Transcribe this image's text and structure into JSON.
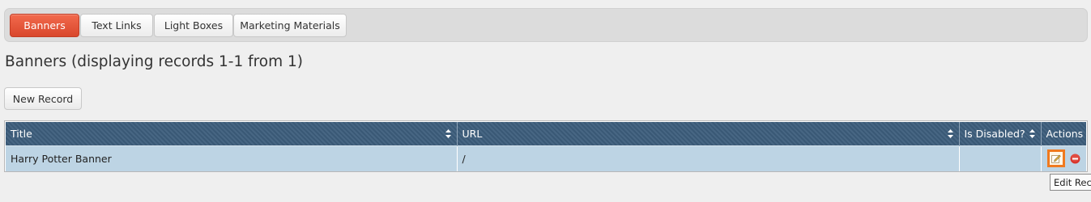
{
  "tabs": [
    {
      "label": "Banners",
      "active": true
    },
    {
      "label": "Text Links",
      "active": false
    },
    {
      "label": "Light Boxes",
      "active": false
    },
    {
      "label": "Marketing Materials",
      "active": false
    }
  ],
  "page_title": "Banners (displaying records 1-1 from 1)",
  "new_record_label": "New Record",
  "table": {
    "columns": [
      "Title",
      "URL",
      "Is Disabled?",
      "Actions"
    ],
    "rows": [
      {
        "title": "Harry Potter Banner",
        "url": "/",
        "is_disabled": ""
      }
    ]
  },
  "tooltip": "Edit Record",
  "colors": {
    "active_tab": "#e0553a",
    "header": "#3d5e7c",
    "row": "#bdd4e4",
    "edit_highlight": "#f07a1f",
    "delete": "#d9342b"
  }
}
